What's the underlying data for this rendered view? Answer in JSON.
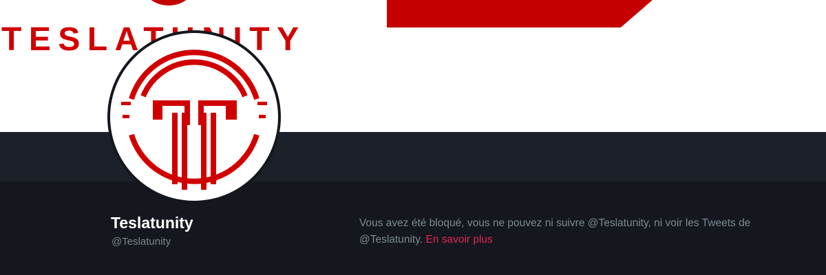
{
  "banner": {
    "wordmark": "TESLATUNITY",
    "colors": {
      "brand_red": "#d10000",
      "background": "#ffffff"
    }
  },
  "profile": {
    "avatar_icon": "teslatunity-logo",
    "display_name": "Teslatunity",
    "handle": "@Teslatunity"
  },
  "blocked_notice": {
    "message": "Vous avez été bloqué, vous ne pouvez ni suivre @Teslatunity, ni voir les Tweets de @Teslatunity.",
    "link_label": "En savoir plus",
    "link_color": "#e0245e"
  },
  "theme": {
    "page_background": "#14171d",
    "strip_background": "#1b2029",
    "name_color": "#ffffff",
    "muted_text": "#7d8895"
  }
}
